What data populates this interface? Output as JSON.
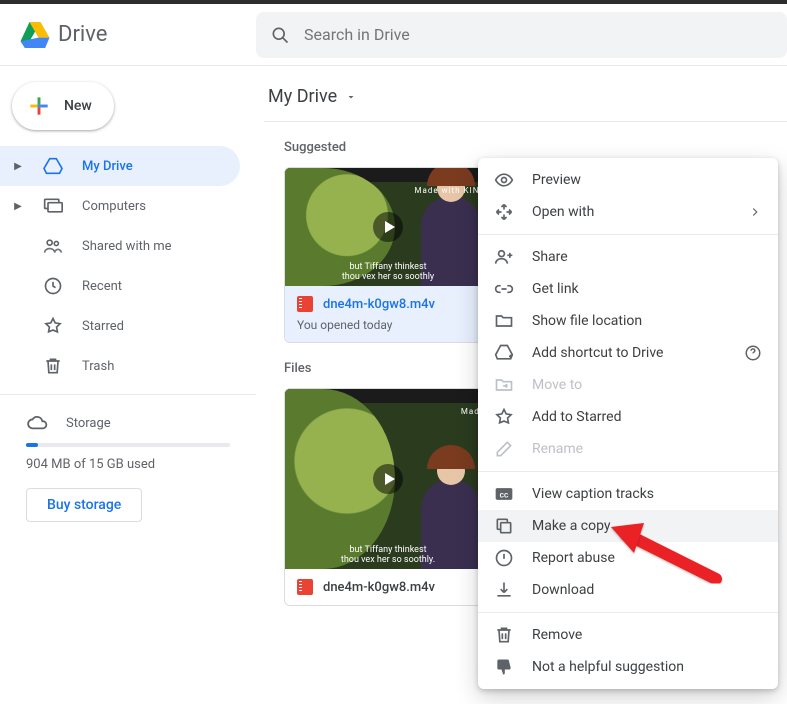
{
  "app": {
    "name": "Drive"
  },
  "search": {
    "placeholder": "Search in Drive"
  },
  "new_button": {
    "label": "New"
  },
  "sidebar": {
    "items": [
      {
        "label": "My Drive",
        "icon": "drive-icon",
        "active": true,
        "has_children": true
      },
      {
        "label": "Computers",
        "icon": "computers-icon",
        "active": false,
        "has_children": true
      },
      {
        "label": "Shared with me",
        "icon": "people-icon",
        "active": false,
        "has_children": false
      },
      {
        "label": "Recent",
        "icon": "clock-icon",
        "active": false,
        "has_children": false
      },
      {
        "label": "Starred",
        "icon": "star-icon",
        "active": false,
        "has_children": false
      },
      {
        "label": "Trash",
        "icon": "trash-icon",
        "active": false,
        "has_children": false
      }
    ]
  },
  "storage": {
    "label": "Storage",
    "used_fraction": 0.06,
    "text": "904 MB of 15 GB used",
    "buy_label": "Buy storage"
  },
  "breadcrumb": {
    "title": "My Drive"
  },
  "suggested": {
    "label": "Suggested",
    "cards": [
      {
        "file_name": "dne4m-k0gw8.m4v",
        "subtitle": "You opened today",
        "watermark": "Made with KINE",
        "subtitle_overlay": "but Tiffany thinkest\\nthou vex her so soothly"
      }
    ]
  },
  "files": {
    "label": "Files",
    "cards": [
      {
        "file_name": "dne4m-k0gw8.m4v",
        "watermark": "Made",
        "subtitle_overlay": "but Tiffany thinkest\\nthou vex her so soothly."
      }
    ]
  },
  "context_menu": {
    "groups": [
      [
        {
          "label": "Preview",
          "icon": "eye-icon",
          "state": "enabled"
        },
        {
          "label": "Open with",
          "icon": "open-with-icon",
          "state": "enabled",
          "has_submenu": true
        }
      ],
      [
        {
          "label": "Share",
          "icon": "person-add-icon",
          "state": "enabled"
        },
        {
          "label": "Get link",
          "icon": "link-icon",
          "state": "enabled"
        },
        {
          "label": "Show file location",
          "icon": "folder-icon",
          "state": "enabled"
        },
        {
          "label": "Add shortcut to Drive",
          "icon": "drive-add-icon",
          "state": "enabled",
          "has_help": true
        },
        {
          "label": "Move to",
          "icon": "move-icon",
          "state": "disabled"
        },
        {
          "label": "Add to Starred",
          "icon": "star-icon",
          "state": "enabled"
        },
        {
          "label": "Rename",
          "icon": "pencil-icon",
          "state": "disabled"
        }
      ],
      [
        {
          "label": "View caption tracks",
          "icon": "cc-icon",
          "state": "enabled"
        },
        {
          "label": "Make a copy",
          "icon": "copy-icon",
          "state": "enabled",
          "highlighted": true
        },
        {
          "label": "Report abuse",
          "icon": "alert-icon",
          "state": "enabled"
        },
        {
          "label": "Download",
          "icon": "download-icon",
          "state": "enabled"
        }
      ],
      [
        {
          "label": "Remove",
          "icon": "trash-icon",
          "state": "enabled"
        },
        {
          "label": "Not a helpful suggestion",
          "icon": "thumb-down-icon",
          "state": "enabled"
        }
      ]
    ]
  },
  "annotation": {
    "arrow_target": "Make a copy"
  }
}
